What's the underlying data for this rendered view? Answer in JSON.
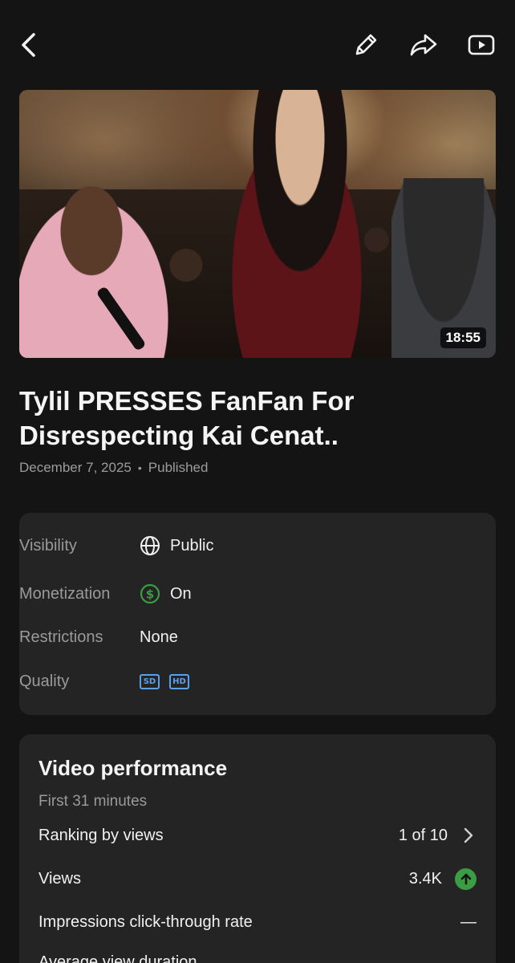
{
  "topbar": {
    "back_icon": "chevron-left-icon",
    "edit_icon": "pencil-icon",
    "share_icon": "share-icon",
    "youtube_icon": "youtube-icon"
  },
  "video": {
    "duration": "18:55",
    "title": "Tylil PRESSES FanFan For Disrespecting Kai Cenat..",
    "date": "December 7, 2025",
    "separator": "•",
    "status": "Published"
  },
  "status_card": {
    "visibility": {
      "label": "Visibility",
      "value": "Public",
      "icon": "globe-icon"
    },
    "monetization": {
      "label": "Monetization",
      "value": "On",
      "icon": "dollar-circle-icon",
      "color": "#3a9c43"
    },
    "restrictions": {
      "label": "Restrictions",
      "value": "None"
    },
    "quality": {
      "label": "Quality",
      "badges": [
        "SD",
        "HD"
      ],
      "color": "#5aa0e8"
    }
  },
  "performance": {
    "title": "Video performance",
    "subtitle": "First 31 minutes",
    "rows": [
      {
        "label": "Ranking by views",
        "value": "1 of 10",
        "icon": "chevron-right-icon"
      },
      {
        "label": "Views",
        "value": "3.4K",
        "icon": "arrow-up-circle-icon",
        "color": "#3a9c43"
      },
      {
        "label": "Impressions click-through rate",
        "value": "—"
      },
      {
        "label": "Average view duration",
        "value": ""
      }
    ]
  }
}
